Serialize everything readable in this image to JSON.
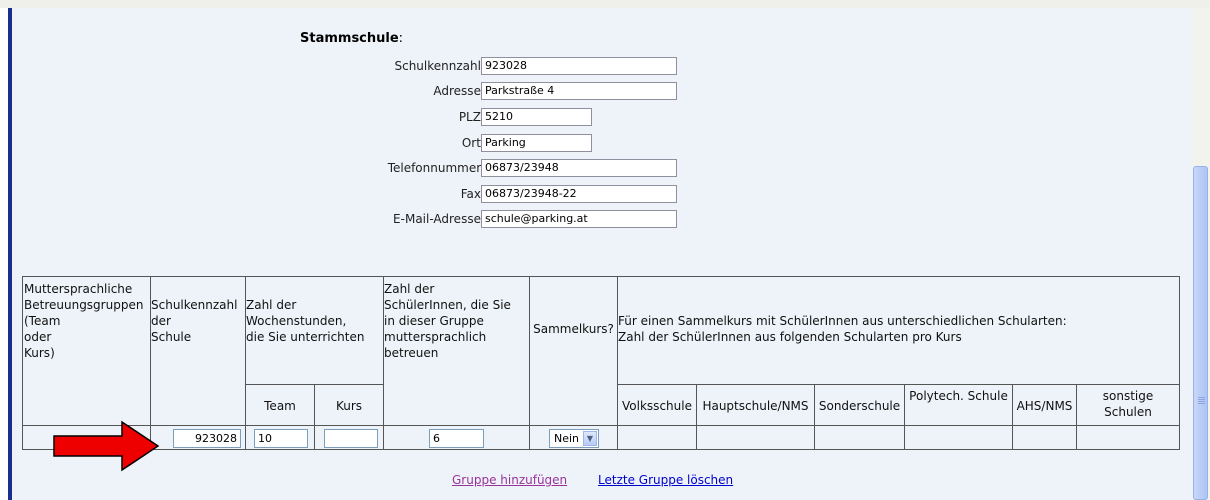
{
  "school": {
    "section_title": "Stammschule",
    "section_colon": ":",
    "fields": [
      {
        "label": "Schulkennzahl:",
        "value": "923028"
      },
      {
        "label": "Adresse:",
        "value": "Parkstraße 4"
      },
      {
        "label": "PLZ:",
        "value": "5210"
      },
      {
        "label": "Ort:",
        "value": "Parking"
      },
      {
        "label": "Telefonnummer:",
        "value": "06873/23948"
      },
      {
        "label": "Fax:",
        "value": "06873/23948-22"
      },
      {
        "label": "E-Mail-Adresse:",
        "value": "schule@parking.at"
      }
    ]
  },
  "table": {
    "headers": {
      "col1": [
        "Muttersprachliche",
        "Betreuungsgruppen",
        "(Team",
        "oder",
        "Kurs)"
      ],
      "col2": [
        "Schulkennzahl",
        "der",
        "Schule"
      ],
      "col3": [
        "Zahl der",
        "Wochenstunden,",
        "die Sie unterrichten"
      ],
      "col3_sub": [
        "Team",
        "Kurs"
      ],
      "col4": [
        "Zahl der",
        "SchülerInnen, die Sie",
        "in dieser Gruppe",
        "muttersprachlich",
        "betreuen"
      ],
      "col5": "Sammelkurs?",
      "col6": [
        "Für einen Sammelkurs mit SchülerInnen aus unterschiedlichen Schularten:",
        "Zahl der SchülerInnen aus folgenden Schularten pro Kurs"
      ],
      "col6_sub": [
        "Volksschule",
        "Hauptschule/NMS",
        "Sonderschule",
        "Polytech. Schule",
        "AHS/NMS",
        "sonstige Schulen"
      ]
    },
    "row": {
      "schulkennzahl": "923028",
      "team": "10",
      "kurs": "",
      "schueler": "6",
      "sammelkurs": "Nein"
    }
  },
  "links": {
    "add": "Gruppe hinzufügen",
    "delete": "Letzte Gruppe löschen"
  },
  "colors": {
    "link_add": "#993399",
    "link_delete": "#0000cc",
    "arrow": "#ee0000"
  }
}
